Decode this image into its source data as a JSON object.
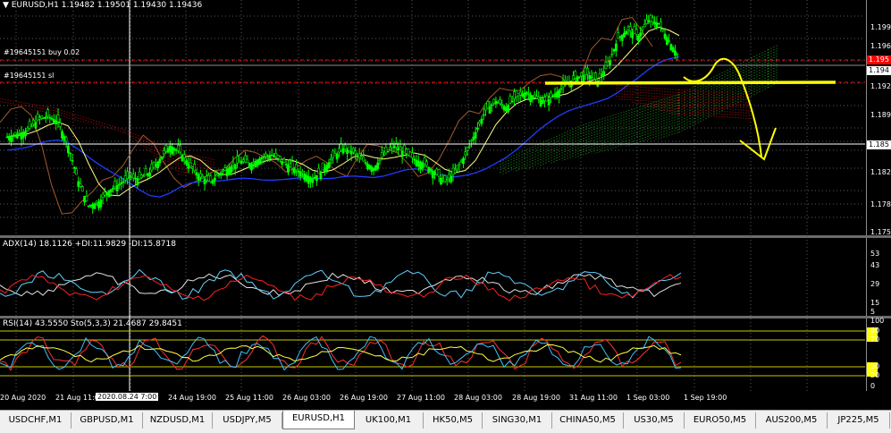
{
  "main_header": "EURUSD,H1  1.19482 1.19501 1.19430 1.19436",
  "adx_header": "ADX(14) 18.1126 +DI:11.9829 -DI:15.8718",
  "rsi_header": "RSI(14) 43.5550  Sto(5,3,3) 21.4687 29.8451",
  "trades": {
    "buy": "#19645151 buy 0.02",
    "sl": "#19645151 sl"
  },
  "price_axis": [
    "1.199",
    "1.196",
    "1.194",
    "1.192",
    "1.189",
    "1.185",
    "1.182",
    "1.178",
    "1.175"
  ],
  "price_tags": {
    "red": "1.195",
    "white": "1.194",
    "hline": "1.185"
  },
  "adx_axis": [
    "53",
    "43",
    "29",
    "15",
    "5"
  ],
  "rsi_axis": [
    "100",
    "80",
    "70",
    "30",
    "20",
    "0"
  ],
  "time_labels": [
    "20 Aug 2020",
    "21 Aug 11:00",
    "24 Aug 19:00",
    "25 Aug 11:00",
    "26 Aug 03:00",
    "26 Aug 19:00",
    "27 Aug 11:00",
    "28 Aug 03:00",
    "28 Aug 19:00",
    "31 Aug 11:00",
    "1 Sep 03:00",
    "1 Sep 19:00"
  ],
  "cursor_time": "2020.08.24 7:00",
  "tabs": [
    {
      "label": "USDCHF,M1",
      "active": false
    },
    {
      "label": "GBPUSD,M1",
      "active": false
    },
    {
      "label": "NZDUSD,M1",
      "active": false
    },
    {
      "label": "USDJPY,M5",
      "active": false
    },
    {
      "label": "EURUSD,H1",
      "active": true
    },
    {
      "label": "UK100,M1",
      "active": false
    },
    {
      "label": "HK50,M5",
      "active": false
    },
    {
      "label": "SING30,M1",
      "active": false
    },
    {
      "label": "CHINA50,M5",
      "active": false
    },
    {
      "label": "US30,M5",
      "active": false
    },
    {
      "label": "EURO50,M5",
      "active": false
    },
    {
      "label": "AUS200,M5",
      "active": false
    },
    {
      "label": "JP225,M5",
      "active": false
    }
  ],
  "colors": {
    "bull_candle": "#00ff00",
    "price_red": "#ff0000",
    "annotation": "#ffff00",
    "ma_blue": "#1f3cff",
    "ma_yellow": "#ffff80",
    "ma_brown": "#a05a2c",
    "di_plus": "#60d0ff",
    "di_minus": "#ff2020"
  },
  "chart_data": {
    "type": "candlestick",
    "symbol": "EURUSD",
    "timeframe": "H1",
    "ylim": [
      1.175,
      1.2
    ],
    "close_path": [
      1.1855,
      1.1858,
      1.1862,
      1.1874,
      1.1878,
      1.1872,
      1.1845,
      1.1805,
      1.1778,
      1.1782,
      1.1795,
      1.1802,
      1.181,
      1.1808,
      1.1815,
      1.183,
      1.1845,
      1.1838,
      1.1822,
      1.181,
      1.1805,
      1.1815,
      1.1822,
      1.1828,
      1.1825,
      1.1832,
      1.1835,
      1.1828,
      1.182,
      1.1815,
      1.1808,
      1.1818,
      1.1832,
      1.1842,
      1.1838,
      1.1828,
      1.182,
      1.1835,
      1.1845,
      1.1838,
      1.183,
      1.1825,
      1.1815,
      1.1805,
      1.1815,
      1.1835,
      1.186,
      1.1885,
      1.1895,
      1.1888,
      1.19,
      1.1905,
      1.1898,
      1.1895,
      1.1905,
      1.1915,
      1.1922,
      1.1925,
      1.1918,
      1.1935,
      1.1965,
      1.1975,
      1.1968,
      1.1985,
      1.1982,
      1.1962,
      1.1944
    ],
    "hline_white": 1.185,
    "hline_red_dashed": [
      1.1952,
      1.1922
    ]
  }
}
